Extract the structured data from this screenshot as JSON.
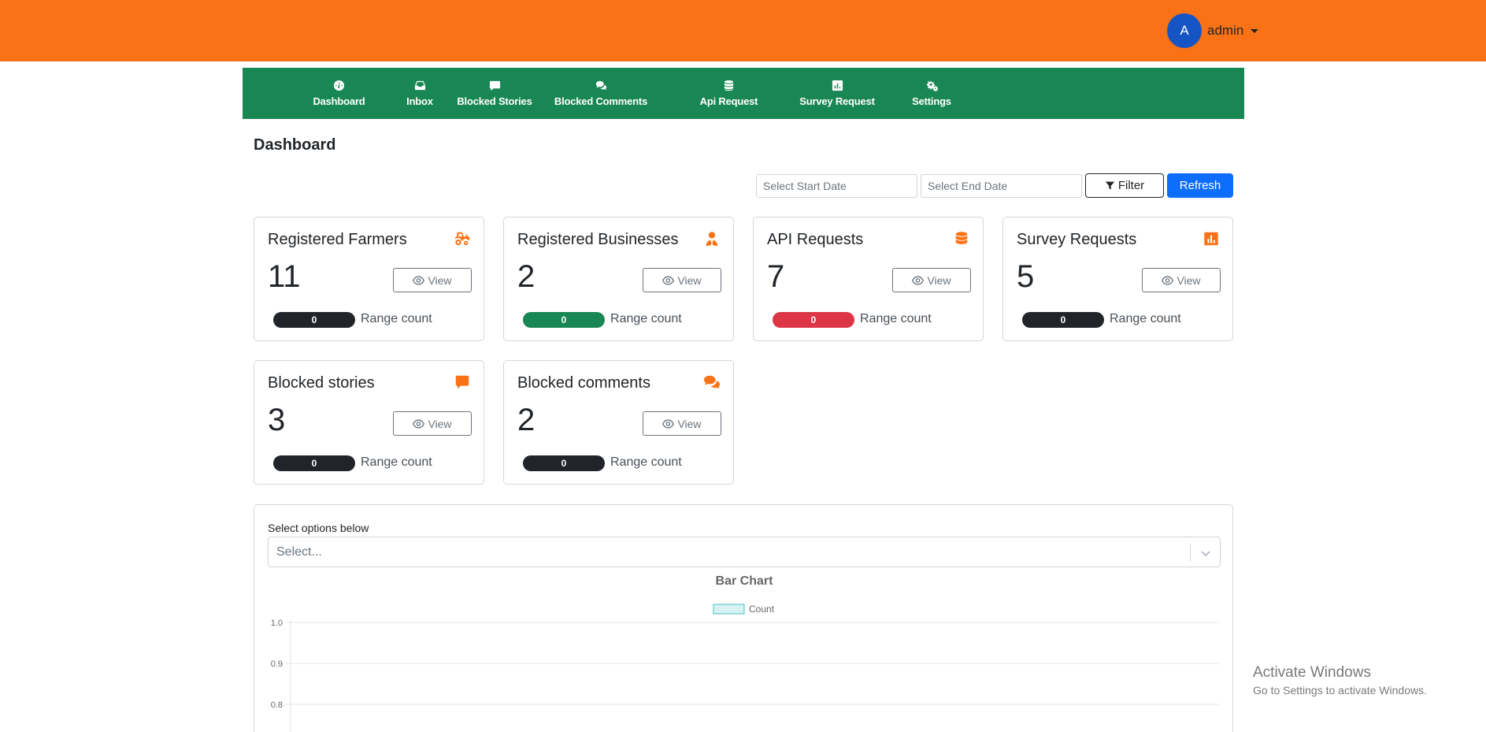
{
  "header": {
    "user": {
      "avatar_letter": "A",
      "name": "admin"
    },
    "colors": {
      "topbar": "#f97316",
      "avatar": "#1654c4"
    }
  },
  "nav": {
    "color": "#198754",
    "items": [
      {
        "label": "Dashboard",
        "icon": "speedometer-icon"
      },
      {
        "label": "Inbox",
        "icon": "inbox-icon"
      },
      {
        "label": "Blocked Stories",
        "icon": "message-icon"
      },
      {
        "label": "Blocked Comments",
        "icon": "comments-icon"
      },
      {
        "label": "Api Request",
        "icon": "database-icon"
      },
      {
        "label": "Survey Request",
        "icon": "bar-chart-icon"
      },
      {
        "label": "Settings",
        "icon": "gears-icon"
      }
    ]
  },
  "page": {
    "title": "Dashboard"
  },
  "filters": {
    "start_placeholder": "Select Start Date",
    "end_placeholder": "Select End Date",
    "filter_label": "Filter",
    "refresh_label": "Refresh"
  },
  "cards": [
    {
      "title": "Registered Farmers",
      "count": "11",
      "view_label": "View",
      "range_value": "0",
      "range_label": "Range count",
      "badge_color": "#212529",
      "icon": "tractor-icon"
    },
    {
      "title": "Registered Businesses",
      "count": "2",
      "view_label": "View",
      "range_value": "0",
      "range_label": "Range count",
      "badge_color": "#198754",
      "icon": "user-tie-icon"
    },
    {
      "title": "API Requests",
      "count": "7",
      "view_label": "View",
      "range_value": "0",
      "range_label": "Range count",
      "badge_color": "#dc3545",
      "icon": "database-icon"
    },
    {
      "title": "Survey Requests",
      "count": "5",
      "view_label": "View",
      "range_value": "0",
      "range_label": "Range count",
      "badge_color": "#212529",
      "icon": "chart-square-icon"
    },
    {
      "title": "Blocked stories",
      "count": "3",
      "view_label": "View",
      "range_value": "0",
      "range_label": "Range count",
      "badge_color": "#212529",
      "icon": "message-icon"
    },
    {
      "title": "Blocked comments",
      "count": "2",
      "view_label": "View",
      "range_value": "0",
      "range_label": "Range count",
      "badge_color": "#212529",
      "icon": "comments-icon"
    }
  ],
  "chart_section": {
    "select_label": "Select options below",
    "select_placeholder": "Select..."
  },
  "chart_data": {
    "type": "bar",
    "title": "Bar Chart",
    "series": [
      {
        "name": "Count",
        "values": []
      }
    ],
    "categories": [],
    "yticks": [
      "1.0",
      "0.9",
      "0.8"
    ],
    "ylim": [
      0,
      1.0
    ],
    "grid": true,
    "legend": "top-center",
    "colors": {
      "fill": "#d6f2f2",
      "stroke": "#4bc0c0"
    }
  },
  "watermark": {
    "line1": "Activate Windows",
    "line2": "Go to Settings to activate Windows."
  }
}
